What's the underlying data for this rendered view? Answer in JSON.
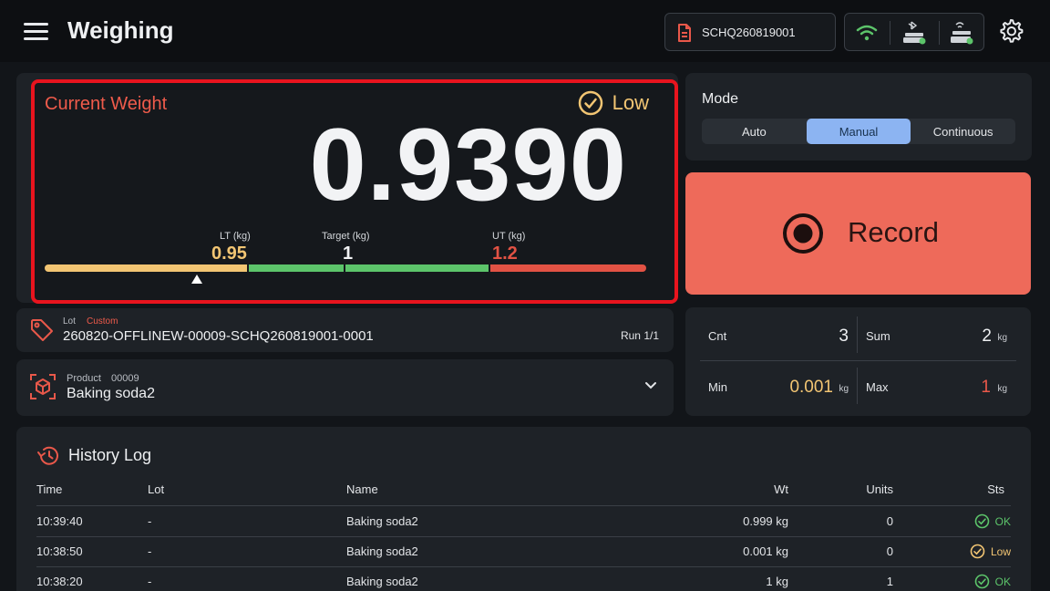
{
  "header": {
    "title": "Weighing",
    "document_id": "SCHQ260819001",
    "icons": [
      "menu-icon",
      "document-icon",
      "wifi-icon",
      "bluetooth-scale-icon",
      "wireless-scale-icon",
      "gear-icon"
    ]
  },
  "weight": {
    "label": "Current Weight",
    "value": "0.9390",
    "status": "Low",
    "lt_label": "LT (kg)",
    "lt_value": "0.95",
    "target_label": "Target (kg)",
    "target_value": "1",
    "ut_label": "UT (kg)",
    "ut_value": "1.2",
    "colors": {
      "low": "#f2c573",
      "ok": "#5cc46a",
      "high": "#e25244"
    }
  },
  "mode": {
    "label": "Mode",
    "options": [
      "Auto",
      "Manual",
      "Continuous"
    ],
    "selected": "Manual"
  },
  "record": {
    "label": "Record"
  },
  "lot": {
    "label": "Lot",
    "tag": "Custom",
    "value": "260820-OFFLINEW-00009-SCHQ260819001-0001",
    "run": "Run 1/1"
  },
  "product": {
    "label": "Product",
    "code": "00009",
    "name": "Baking soda2"
  },
  "stats": {
    "cnt_label": "Cnt",
    "cnt_value": "3",
    "sum_label": "Sum",
    "sum_value": "2",
    "sum_unit": "kg",
    "min_label": "Min",
    "min_value": "0.001",
    "min_unit": "kg",
    "max_label": "Max",
    "max_value": "1",
    "max_unit": "kg"
  },
  "history": {
    "title": "History Log",
    "columns": [
      "Time",
      "Lot",
      "Name",
      "Wt",
      "Units",
      "Sts"
    ],
    "rows": [
      {
        "time": "10:39:40",
        "lot": "-",
        "name": "Baking soda2",
        "wt": "0.999 kg",
        "units": "0",
        "sts": "OK"
      },
      {
        "time": "10:38:50",
        "lot": "-",
        "name": "Baking soda2",
        "wt": "0.001 kg",
        "units": "0",
        "sts": "Low"
      },
      {
        "time": "10:38:20",
        "lot": "-",
        "name": "Baking soda2",
        "wt": "1 kg",
        "units": "1",
        "sts": "OK"
      }
    ]
  }
}
